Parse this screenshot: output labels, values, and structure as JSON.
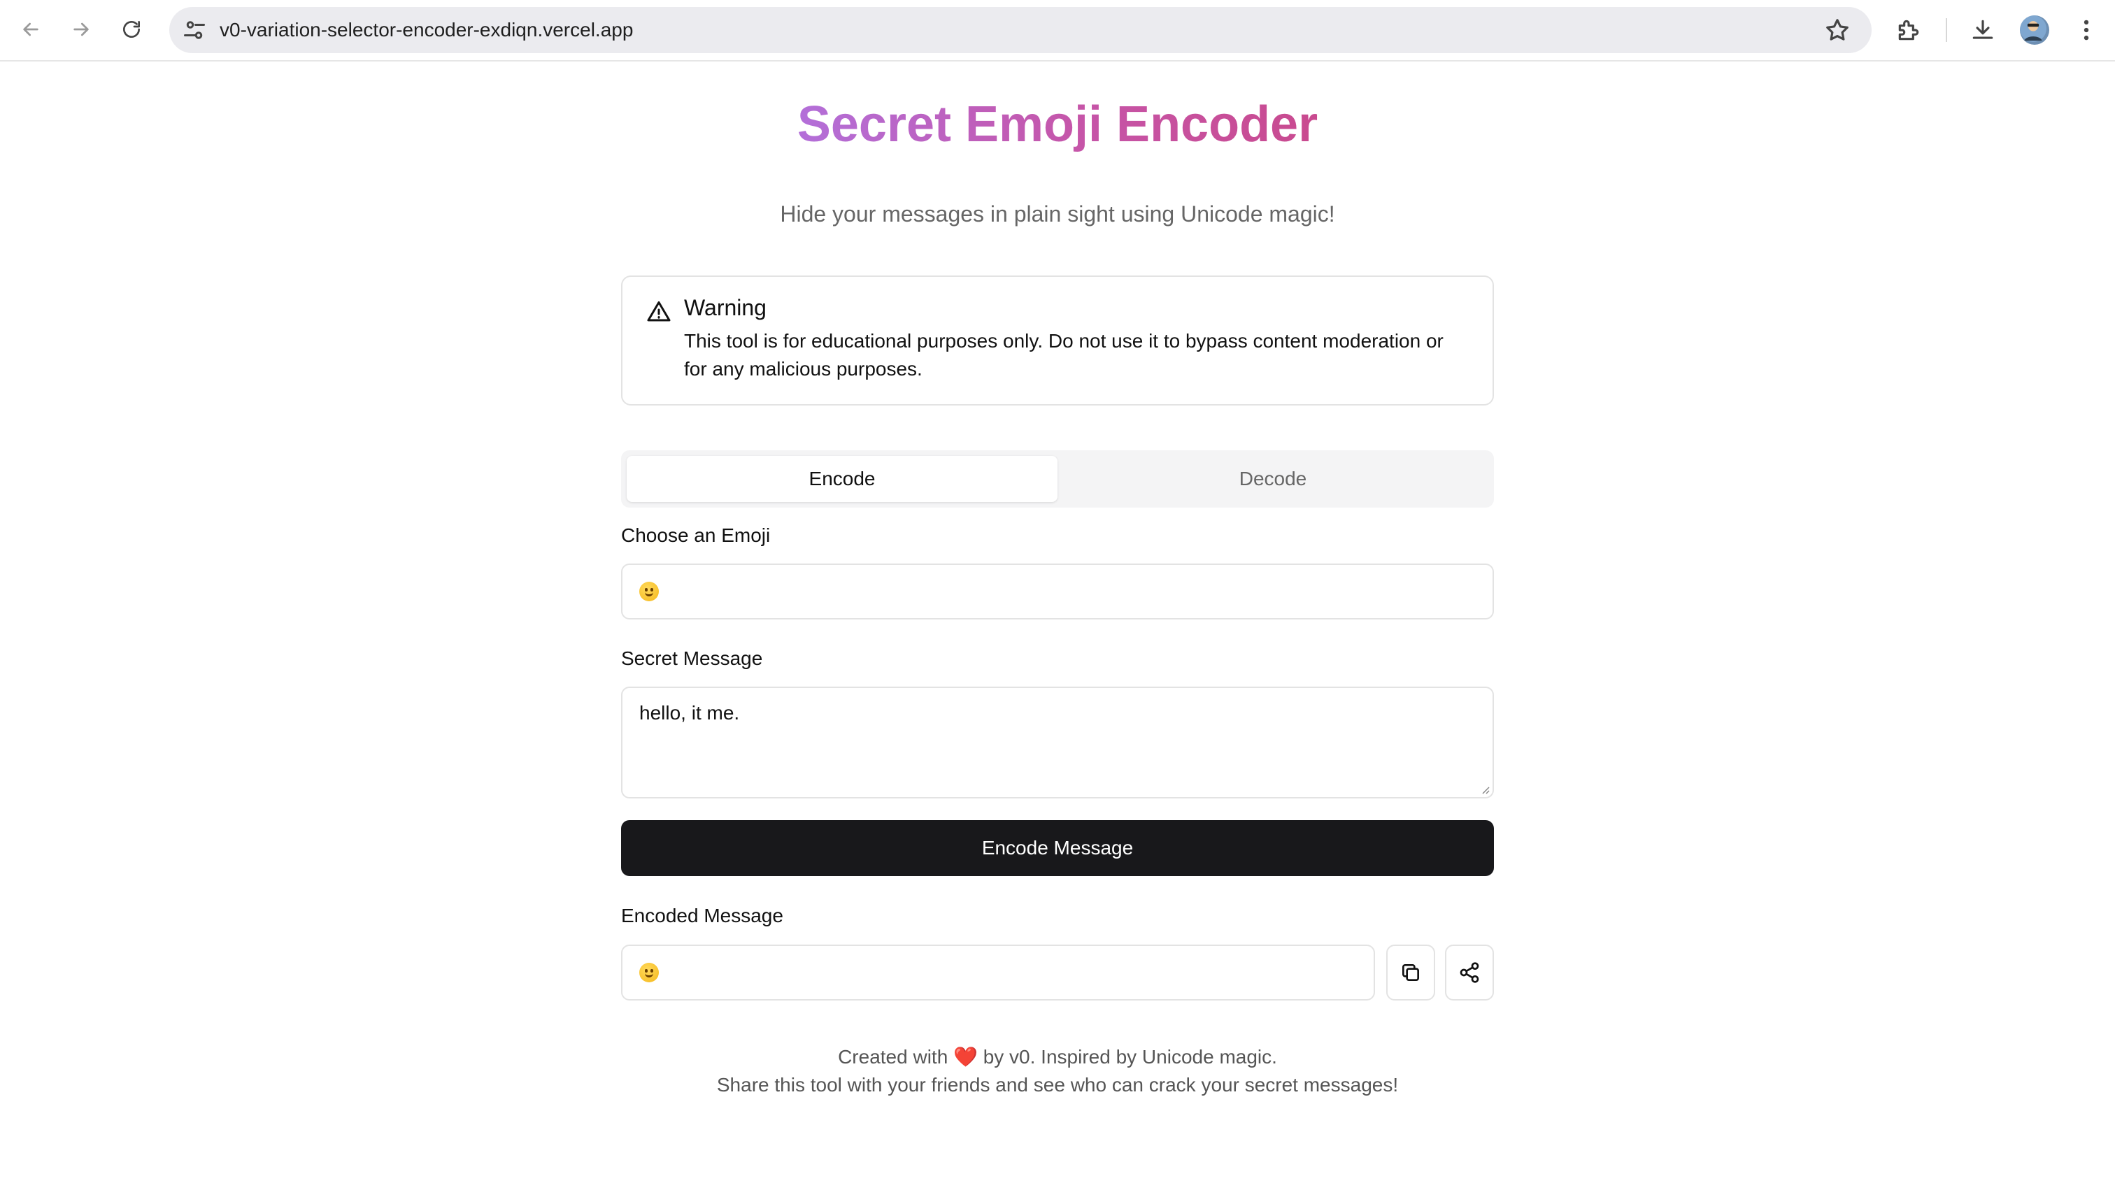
{
  "browser": {
    "url": "v0-variation-selector-encoder-exdiqn.vercel.app"
  },
  "page": {
    "title": "Secret Emoji Encoder",
    "subtitle": "Hide your messages in plain sight using Unicode magic!"
  },
  "warning": {
    "title": "Warning",
    "text": "This tool is for educational purposes only. Do not use it to bypass content moderation or for any malicious purposes."
  },
  "tabs": {
    "encode": "Encode",
    "decode": "Decode",
    "active": "Encode"
  },
  "form": {
    "emoji_label": "Choose an Emoji",
    "emoji_value": "😊",
    "message_label": "Secret Message",
    "message_value": "hello, it me.",
    "encode_button": "Encode Message",
    "encoded_label": "Encoded Message",
    "encoded_value": "😊"
  },
  "footer": {
    "line1_prefix": "Created with",
    "line1_heart": "❤️",
    "line1_suffix": "by v0. Inspired by Unicode magic.",
    "line2": "Share this tool with your friends and see who can crack your secret messages!"
  },
  "colors": {
    "title_gradient_start": "#b36fd9",
    "title_gradient_end": "#c94a8f",
    "primary_button": "#18181b"
  },
  "icons": [
    "back-icon",
    "forward-icon",
    "reload-icon",
    "site-settings-icon",
    "star-icon",
    "extensions-icon",
    "download-icon",
    "menu-icon",
    "warning-icon",
    "copy-icon",
    "share-icon"
  ]
}
